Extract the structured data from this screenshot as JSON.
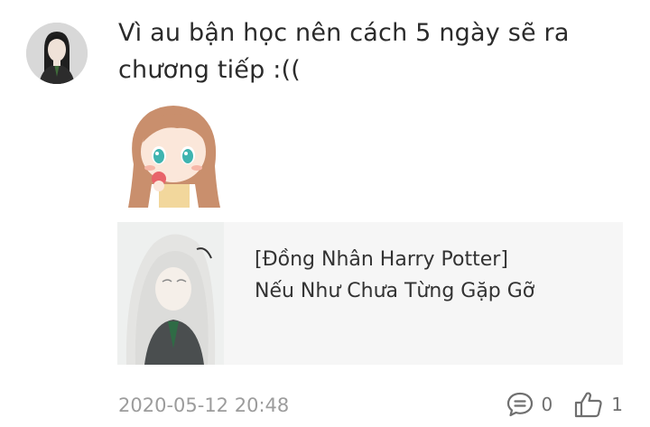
{
  "comment": {
    "text_line1": "Vì au bận học nên cách 5 ngày sẽ ra",
    "text_line2": "chương tiếp :(("
  },
  "book": {
    "title_line1": "[Đồng Nhân Harry Potter]",
    "title_line2": "Nếu Như Chưa Từng Gặp Gỡ"
  },
  "footer": {
    "timestamp": "2020-05-12 20:48",
    "reply_count": "0",
    "like_count": "1"
  },
  "icons": {
    "reply": "comment-bubble-icon",
    "like": "thumbs-up-icon"
  },
  "colors": {
    "text": "#2b2b2b",
    "muted": "#9c9c9c",
    "card_bg": "#f6f6f6"
  }
}
